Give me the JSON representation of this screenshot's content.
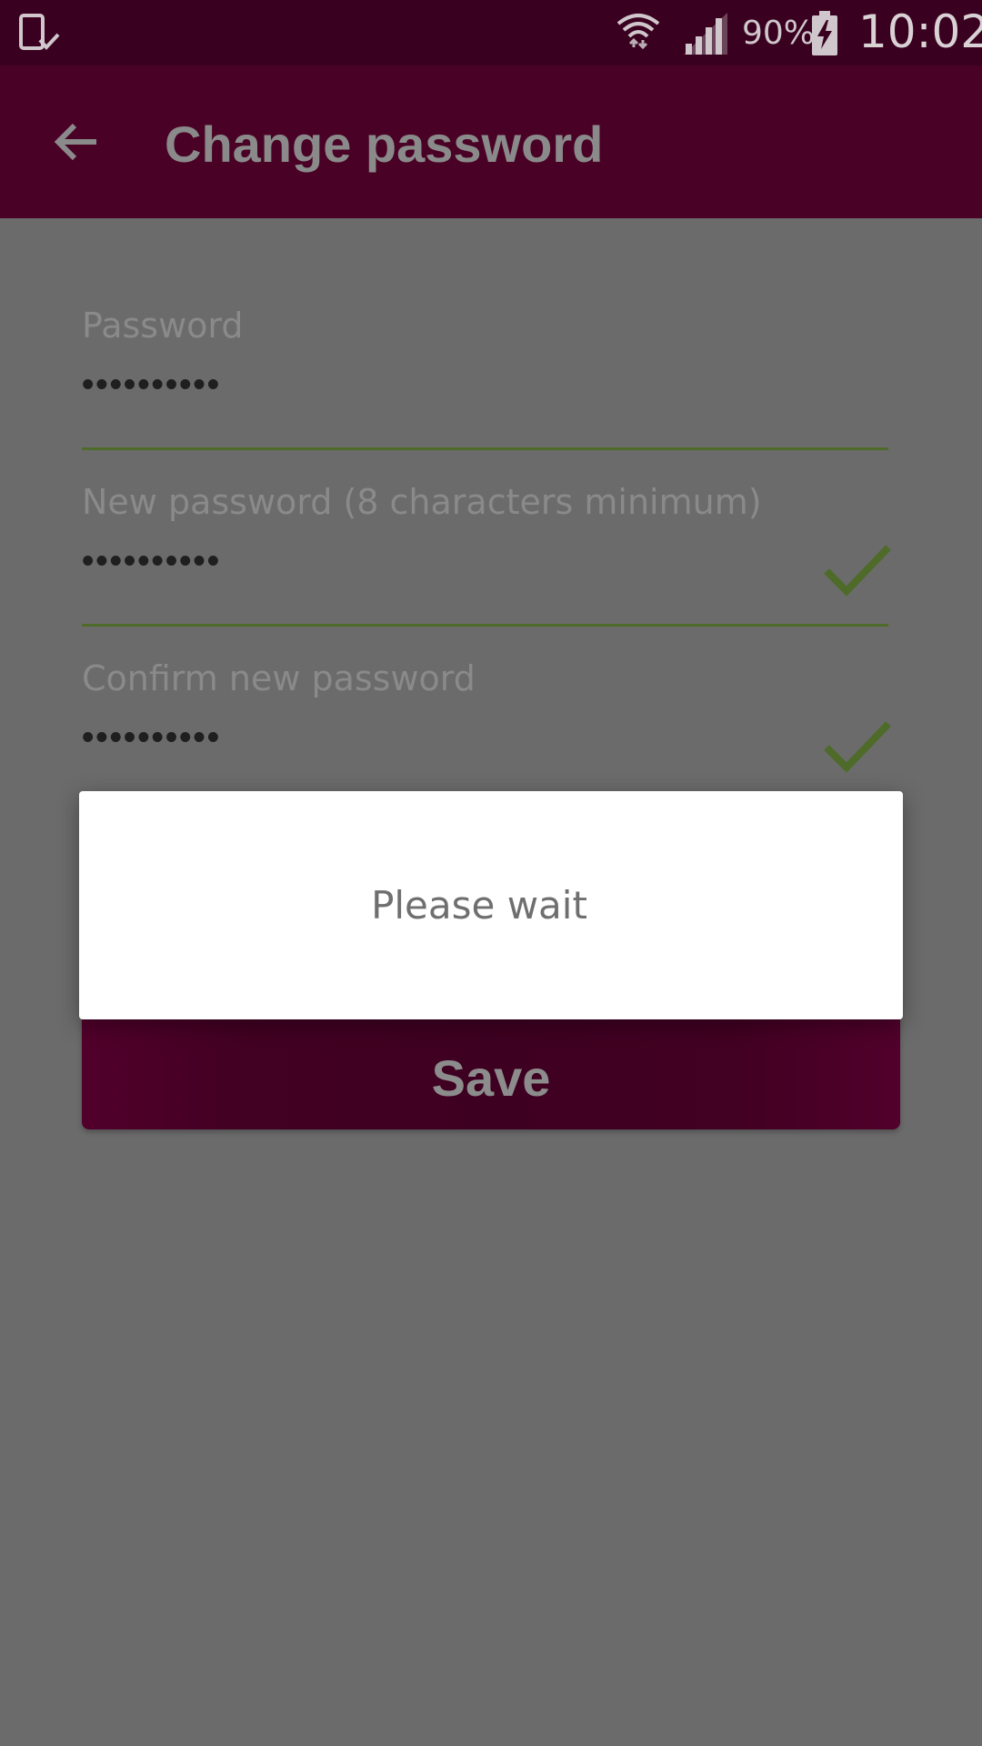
{
  "status_bar": {
    "battery_percent": "90%",
    "time": "10:02",
    "icons": [
      "device-check-icon",
      "wifi-icon",
      "signal-icon",
      "battery-charging-icon"
    ]
  },
  "app_bar": {
    "title": "Change password",
    "back_icon": "arrow-back-icon"
  },
  "form": {
    "password": {
      "label": "Password",
      "value": "••••••••••"
    },
    "new_password": {
      "label": "New password (8 characters minimum)",
      "value": "••••••••••",
      "valid": true
    },
    "confirm_password": {
      "label": "Confirm new password",
      "value": "••••••••••",
      "valid": true
    },
    "save_label": "Save"
  },
  "dialog": {
    "message": "Please wait"
  },
  "colors": {
    "status_bar": "#3a0020",
    "app_bar": "#4a0126",
    "scrim_background": "#6b6b6b",
    "accent_green": "#4e6b29",
    "dialog_background": "#ffffff"
  }
}
